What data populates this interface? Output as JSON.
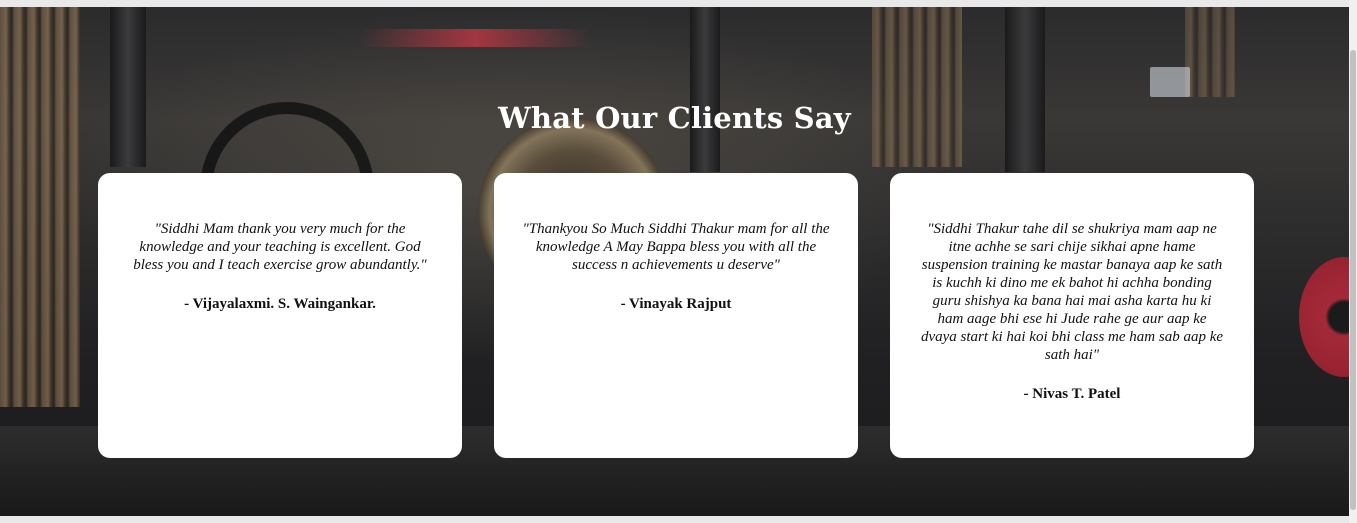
{
  "section": {
    "title": "What Our Clients Say"
  },
  "testimonials": [
    {
      "quote": "\"Siddhi Mam thank you very much for the knowledge and your teaching is excellent. God bless you and I teach exercise grow abundantly.\"",
      "author": "- Vijayalaxmi. S. Waingankar."
    },
    {
      "quote": "\"Thankyou So Much Siddhi Thakur mam for all the knowledge A May Bappa bless you with all the success n achievements u deserve\"",
      "author": "- Vinayak Rajput"
    },
    {
      "quote": "\"Siddhi Thakur tahe dil se shukriya mam aap ne itne achhe se sari chije sikhai apne hame suspension training ke mastar banaya aap ke sath is kuchh ki dino me ek bahot hi achha bonding guru shishya ka bana hai mai asha karta hu ki ham aage bhi ese hi Jude rahe ge aur aap ke dvaya start ki hai koi bhi class me ham sab aap ke sath hai\"",
      "author": "- Nivas T. Patel"
    }
  ],
  "colors": {
    "title": "#ffffff",
    "card_background": "#ffffff",
    "text": "#111111"
  },
  "icons": {
    "background": "gym-background-image"
  }
}
